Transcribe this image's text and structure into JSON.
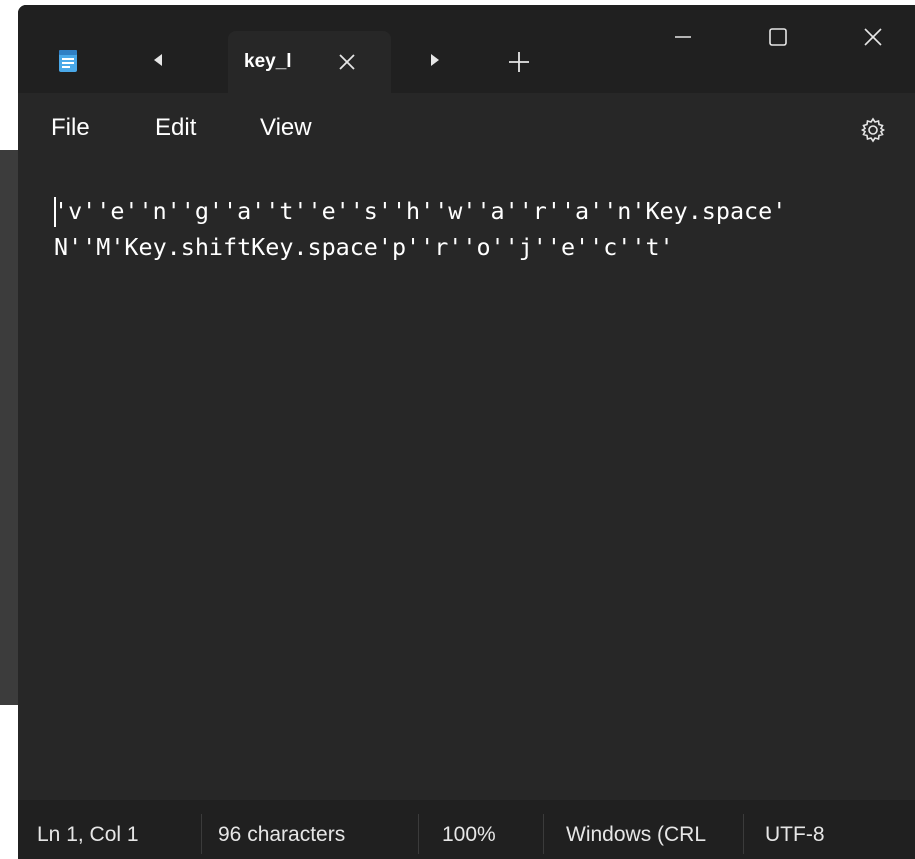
{
  "window": {
    "tab_title": "key_lc",
    "icons": {
      "app": "notepad-icon",
      "tab_prev": "caret-left-icon",
      "tab_next": "caret-right-icon",
      "tab_close": "close-icon",
      "new_tab": "plus-icon",
      "minimize": "minimize-icon",
      "maximize": "maximize-icon",
      "close": "close-icon",
      "settings": "gear-icon"
    }
  },
  "menu": {
    "file": "File",
    "edit": "Edit",
    "view": "View"
  },
  "editor": {
    "lines": [
      "'v''e''n''g''a''t''e''s''h''w''a''r''a''n'Key.space'",
      "N''M'Key.shiftKey.space'p''r''o''j''e''c''t'"
    ]
  },
  "status": {
    "position": "Ln 1, Col 1",
    "characters": "96 characters",
    "zoom": "100%",
    "line_ending": "Windows (CRL",
    "encoding": "UTF-8"
  },
  "colors": {
    "titlebar": "#202020",
    "editor_bg": "#272727",
    "text": "#ffffff",
    "app_icon": "#4aa8e8"
  }
}
